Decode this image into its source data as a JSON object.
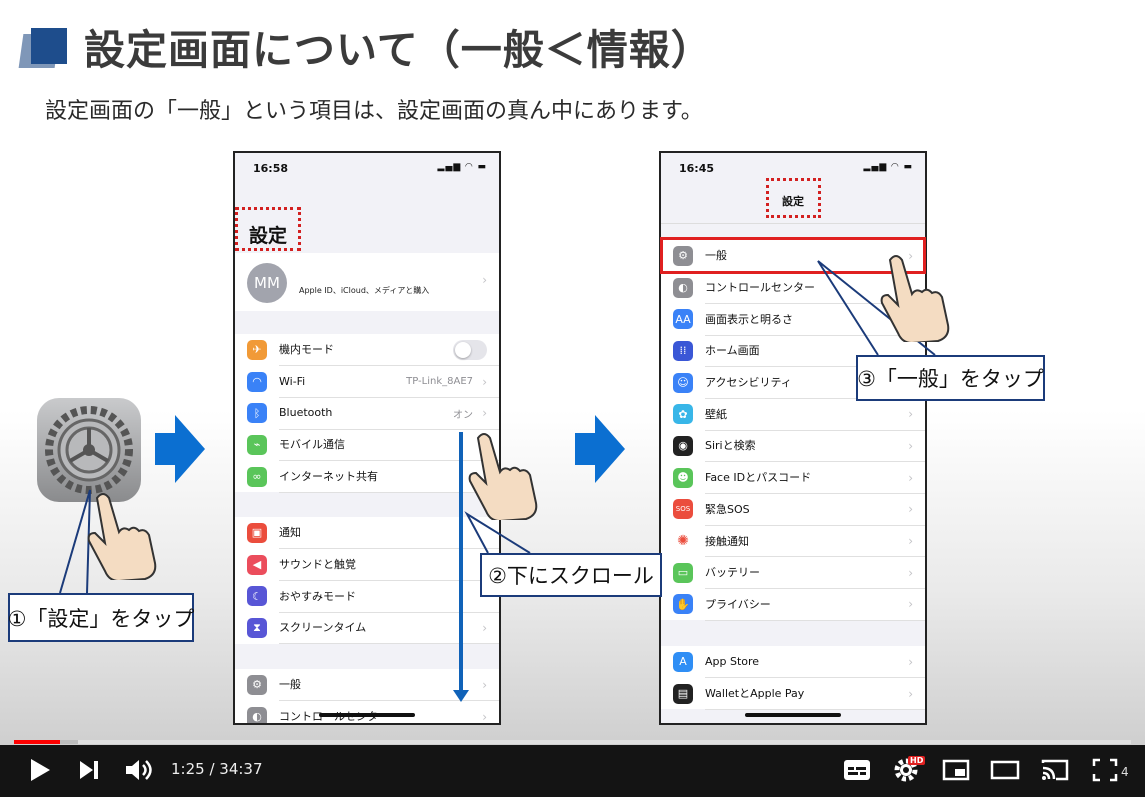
{
  "slide": {
    "title": "設定画面について（一般＜情報）",
    "subtitle": "設定画面の「一般」という項目は、設定画面の真ん中にあります。",
    "callout1": "①「設定」をタップ",
    "callout2": "②下にスクロール",
    "callout3": "③「一般」をタップ",
    "accent_color": "#0b6fd1"
  },
  "phone1": {
    "time": "16:58",
    "header": "設定",
    "profile": {
      "initials": "MM",
      "subtitle": "Apple ID、iCloud、メディアと購入"
    },
    "group1": [
      {
        "label": "機内モード",
        "icon": "airplane-icon",
        "color": "#f19a37",
        "value": ""
      },
      {
        "label": "Wi-Fi",
        "icon": "wifi-icon",
        "color": "#3a82f7",
        "value": "TP-Link_8AE7"
      },
      {
        "label": "Bluetooth",
        "icon": "bluetooth-icon",
        "color": "#3a82f7",
        "value": "オン"
      },
      {
        "label": "モバイル通信",
        "icon": "antenna-icon",
        "color": "#5ac55a",
        "value": ""
      },
      {
        "label": "インターネット共有",
        "icon": "link-icon",
        "color": "#5ac55a",
        "value": ""
      }
    ],
    "group2": [
      {
        "label": "通知",
        "icon": "notification-icon",
        "color": "#eb4d3d"
      },
      {
        "label": "サウンドと触覚",
        "icon": "speaker-icon",
        "color": "#eb4d5c"
      },
      {
        "label": "おやすみモード",
        "icon": "moon-icon",
        "color": "#5856d6"
      },
      {
        "label": "スクリーンタイム",
        "icon": "hourglass-icon",
        "color": "#5856d6"
      }
    ],
    "group3": [
      {
        "label": "一般",
        "icon": "gear-icon",
        "color": "#8e8e93"
      },
      {
        "label": "コントロールセンター",
        "icon": "toggle-icon",
        "color": "#8e8e93"
      }
    ]
  },
  "phone2": {
    "time": "16:45",
    "header": "設定",
    "group1": [
      {
        "label": "一般",
        "icon": "gear-icon",
        "color": "#8e8e93"
      },
      {
        "label": "コントロールセンター",
        "icon": "toggle-icon",
        "color": "#8e8e93"
      },
      {
        "label": "画面表示と明るさ",
        "icon": "aa-icon",
        "color": "#3a82f7"
      },
      {
        "label": "ホーム画面",
        "icon": "grid-icon",
        "color": "#3a57d6"
      },
      {
        "label": "アクセシビリティ",
        "icon": "accessibility-icon",
        "color": "#3a82f7"
      },
      {
        "label": "壁紙",
        "icon": "flower-icon",
        "color": "#38b6e8"
      },
      {
        "label": "Siriと検索",
        "icon": "siri-icon",
        "color": "#222"
      },
      {
        "label": "Face IDとパスコード",
        "icon": "faceid-icon",
        "color": "#5ac55a"
      },
      {
        "label": "緊急SOS",
        "icon": "sos-icon",
        "color": "#eb4d3d"
      },
      {
        "label": "接触通知",
        "icon": "exposure-icon",
        "color": "#fff"
      },
      {
        "label": "バッテリー",
        "icon": "battery-icon",
        "color": "#5ac55a"
      },
      {
        "label": "プライバシー",
        "icon": "hand-icon",
        "color": "#3a82f7"
      }
    ],
    "group2": [
      {
        "label": "App Store",
        "icon": "appstore-icon",
        "color": "#2f8ef5"
      },
      {
        "label": "WalletとApple Pay",
        "icon": "wallet-icon",
        "color": "#222"
      }
    ]
  },
  "player": {
    "time": "1:25 / 34:37",
    "progress_fraction": 0.041,
    "badge_hd": "HD",
    "extra": "4"
  }
}
